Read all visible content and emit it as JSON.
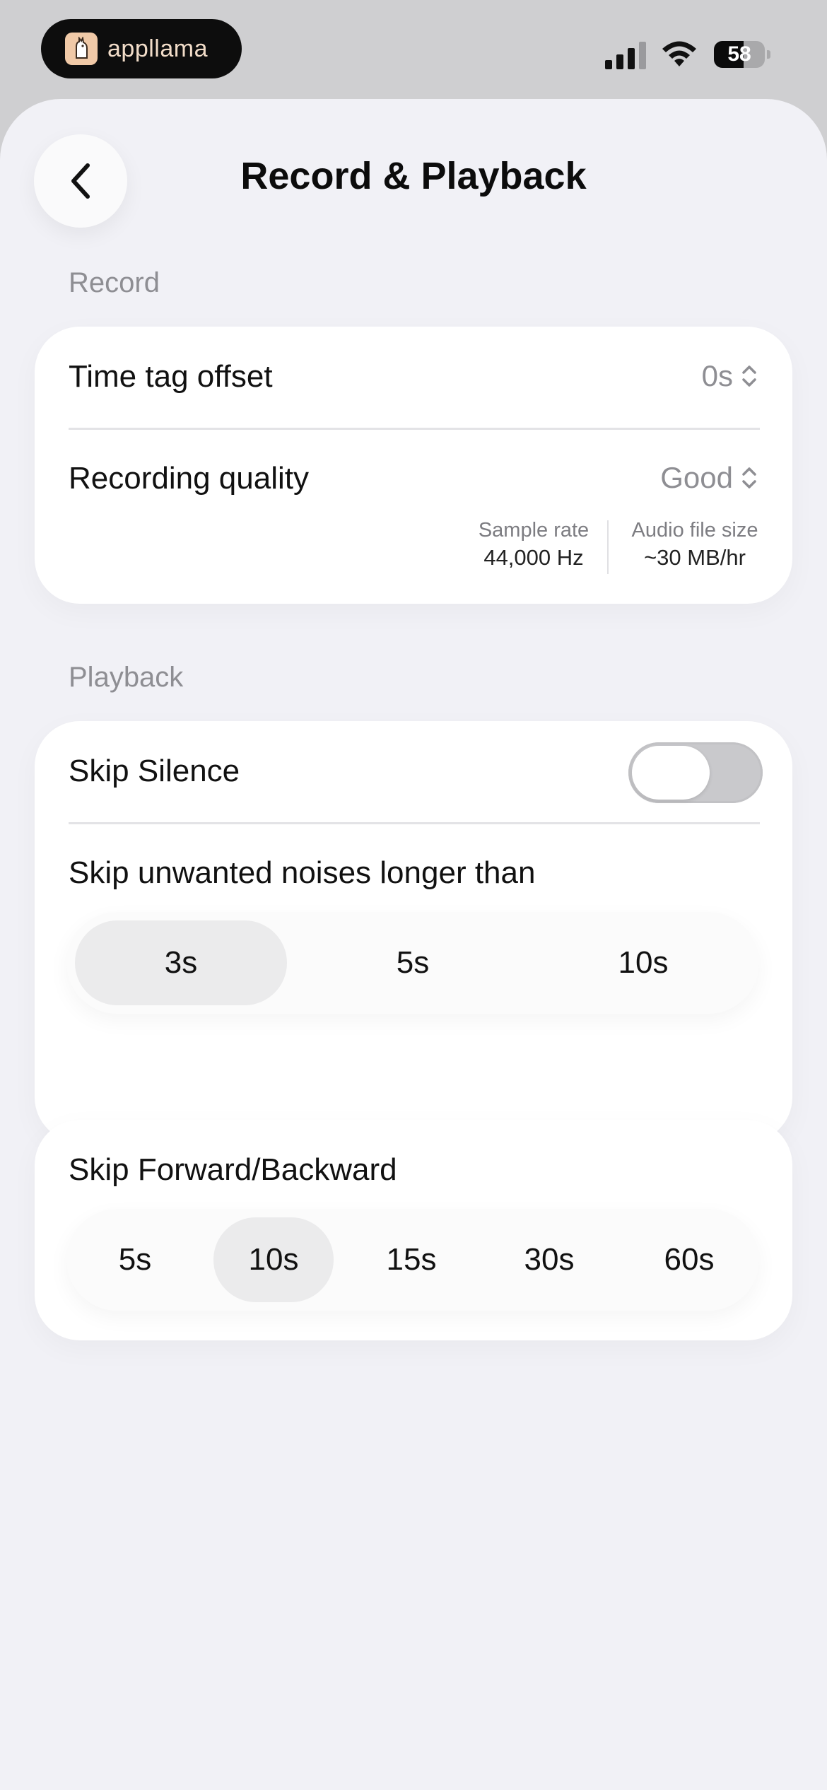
{
  "status_bar": {
    "app_name": "appllama",
    "app_icon": "llama-icon",
    "battery_percent": "58",
    "battery_level": 0.58
  },
  "header": {
    "title": "Record & Playback",
    "back_icon": "chevron-left-icon"
  },
  "record": {
    "section_label": "Record",
    "time_tag_offset": {
      "label": "Time tag offset",
      "value": "0s"
    },
    "recording_quality": {
      "label": "Recording quality",
      "value": "Good",
      "sample_rate_label": "Sample rate",
      "sample_rate_value": "44,000 Hz",
      "file_size_label": "Audio file size",
      "file_size_value": "~30 MB/hr"
    }
  },
  "playback": {
    "section_label": "Playback",
    "skip_silence": {
      "label": "Skip Silence",
      "enabled": false
    },
    "skip_noises": {
      "label": "Skip unwanted noises longer than",
      "options": [
        "3s",
        "5s",
        "10s"
      ],
      "selected_index": 0
    },
    "skip_forward_backward": {
      "label": "Skip Forward/Backward",
      "options": [
        "5s",
        "10s",
        "15s",
        "30s",
        "60s"
      ],
      "selected_index": 1
    }
  },
  "colors": {
    "sheet_background": "#f1f1f6",
    "card_background": "#ffffff",
    "secondary_text": "#8e8e93",
    "selected_segment": "#ebebec",
    "toggle_off": "#c9c9cc"
  }
}
